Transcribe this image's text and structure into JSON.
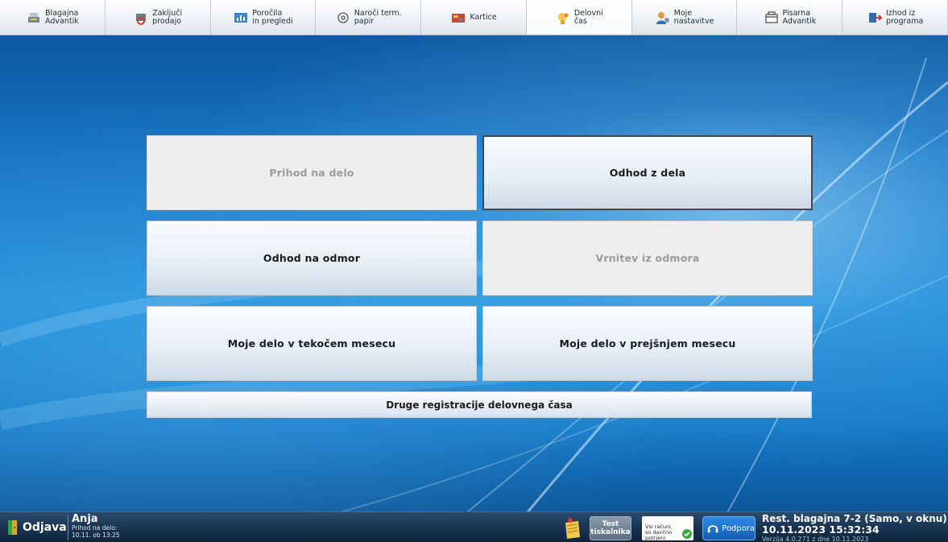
{
  "toolbar": {
    "items": [
      {
        "label": "Blagajna\nAdvantik",
        "icon": "cash-register-icon"
      },
      {
        "label": "Zaključi\nprodajo",
        "icon": "close-sale-icon"
      },
      {
        "label": "Poročila\nin pregledi",
        "icon": "reports-icon"
      },
      {
        "label": "Naroči term.\npapir",
        "icon": "paper-roll-icon"
      },
      {
        "label": "Kartice",
        "icon": "cards-icon"
      },
      {
        "label": "Delovni\nčas",
        "icon": "working-time-icon"
      },
      {
        "label": "Moje\nnastavitve",
        "icon": "user-settings-icon"
      },
      {
        "label": "Pisarna\nAdvantik",
        "icon": "office-icon"
      },
      {
        "label": "Izhod iz\nprograma",
        "icon": "exit-icon"
      }
    ],
    "active_index": 5
  },
  "work_time": {
    "arrival": "Prihod na delo",
    "leave": "Odhod z dela",
    "break_start": "Odhod na odmor",
    "break_end": "Vrnitev iz odmora",
    "this_month": "Moje delo v tekočem mesecu",
    "last_month": "Moje delo v prejšnjem mesecu",
    "other_registrations": "Druge registracije delovnega časa"
  },
  "statusbar": {
    "logout_label": "Odjava",
    "user_name": "Anja",
    "user_arrival": "Prihod na delo:\n10.11. ob 13:25",
    "test_printer": "Test\ntiskalnika",
    "receipts_status": "Vsi računi\nso davčno\npotrjeni",
    "support_label": "Podpora",
    "station": "Rest. blagajna 7-2 (Samo, v oknu)",
    "datetime": "10.11.2023 15:32:34",
    "version": "Verzija 4.0.271 z dne 10.11.2023"
  },
  "colors": {
    "accent_blue": "#1d8ad8",
    "button_text": "#1b1b1b",
    "disabled_text": "#9b9b9b"
  }
}
